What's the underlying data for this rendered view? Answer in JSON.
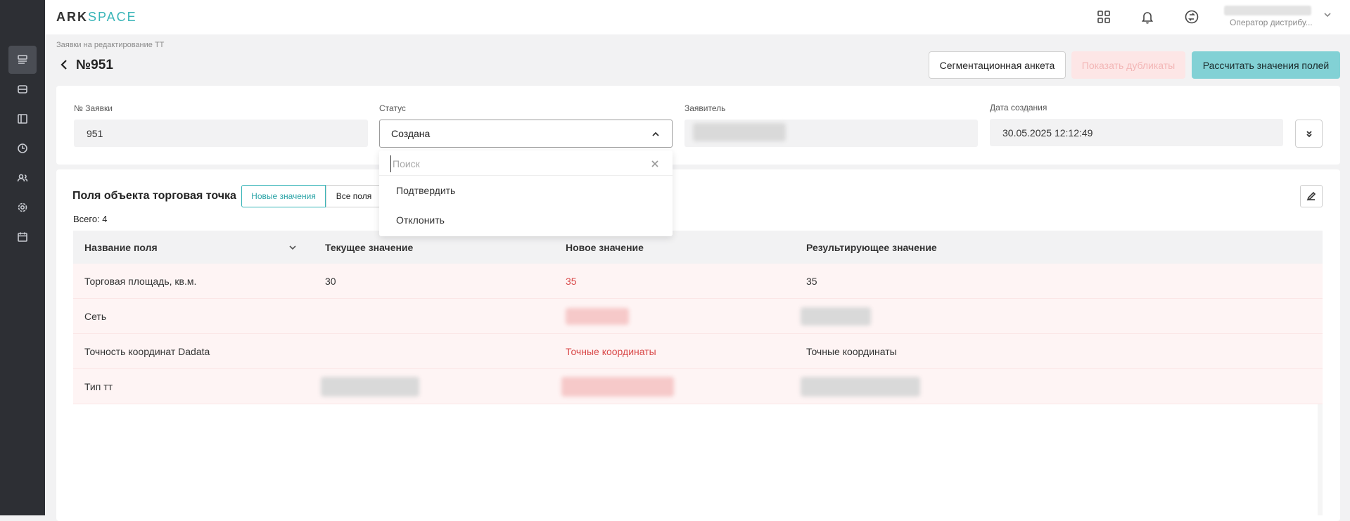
{
  "brand": {
    "part1": "ARK",
    "part2": "SPACE"
  },
  "user": {
    "role": "Оператор дистрибу..."
  },
  "breadcrumb": "Заявки на редактирование ТТ",
  "page_title": "№951",
  "header_buttons": {
    "segmentation": "Сегментационная анкета",
    "show_duplicates": "Показать дубликаты",
    "calculate": "Рассчитать значения полей"
  },
  "fields": {
    "number": {
      "label": "№ Заявки",
      "value": "951"
    },
    "status": {
      "label": "Статус",
      "value": "Создана"
    },
    "applicant": {
      "label": "Заявитель"
    },
    "created": {
      "label": "Дата создания",
      "value": "30.05.2025 12:12:49"
    }
  },
  "status_dropdown": {
    "search_placeholder": "Поиск",
    "options": [
      "Подтвердить",
      "Отклонить"
    ]
  },
  "section": {
    "title": "Поля объекта торговая точка",
    "tabs": [
      "Новые значения",
      "Все поля"
    ],
    "total": "Всего: 4"
  },
  "table": {
    "headers": [
      "Название поля",
      "Текущее значение",
      "Новое значение",
      "Результирующее значение"
    ],
    "rows": [
      {
        "name": "Торговая площадь, кв.м.",
        "current": "30",
        "new": "35",
        "result": "35"
      },
      {
        "name": "Сеть",
        "current": "",
        "new": "",
        "result": ""
      },
      {
        "name": "Точность координат Dadata",
        "current": "",
        "new": "Точные координаты",
        "result": "Точные координаты"
      },
      {
        "name": "Тип тт",
        "current": "",
        "new": "",
        "result": ""
      }
    ]
  },
  "colors": {
    "accent": "#39b5b8",
    "danger": "#d94a4a",
    "sidebar": "#2d2f34"
  }
}
